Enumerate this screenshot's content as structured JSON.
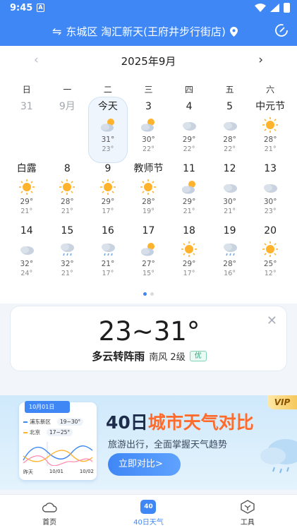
{
  "status_bar": {
    "time": "9:45",
    "notif_glyph": "A"
  },
  "header": {
    "swap_glyph": "⇋",
    "location": "东城区 淘汇新天(王府井步行街店)"
  },
  "calendar": {
    "prev_glyph": "‹",
    "next_glyph": "›",
    "month_title": "2025年9月",
    "weekdays": [
      "日",
      "一",
      "二",
      "三",
      "四",
      "五",
      "六"
    ],
    "weeks": [
      [
        {
          "label": "31",
          "muted": true
        },
        {
          "label": "9月",
          "muted": true
        },
        {
          "label": "今天",
          "icon": "partly-cloudy",
          "hi": "31°",
          "lo": "23°",
          "today": true
        },
        {
          "label": "3",
          "icon": "partly-cloudy",
          "hi": "30°",
          "lo": "22°"
        },
        {
          "label": "4",
          "icon": "cloudy",
          "hi": "29°",
          "lo": "22°"
        },
        {
          "label": "5",
          "icon": "cloudy",
          "hi": "28°",
          "lo": "22°"
        },
        {
          "label": "中元节",
          "icon": "sunny",
          "hi": "28°",
          "lo": "21°"
        }
      ],
      [
        {
          "label": "白露",
          "icon": "sunny",
          "hi": "29°",
          "lo": "21°"
        },
        {
          "label": "8",
          "icon": "sunny",
          "hi": "28°",
          "lo": "21°"
        },
        {
          "label": "9",
          "icon": "sunny",
          "hi": "29°",
          "lo": "17°"
        },
        {
          "label": "教师节",
          "icon": "sunny",
          "hi": "28°",
          "lo": "19°"
        },
        {
          "label": "11",
          "icon": "partly-cloudy",
          "hi": "29°",
          "lo": "21°"
        },
        {
          "label": "12",
          "icon": "cloudy",
          "hi": "30°",
          "lo": "21°"
        },
        {
          "label": "13",
          "icon": "cloudy",
          "hi": "30°",
          "lo": "23°"
        }
      ],
      [
        {
          "label": "14",
          "icon": "cloudy",
          "hi": "32°",
          "lo": "24°"
        },
        {
          "label": "15",
          "icon": "rain",
          "hi": "32°",
          "lo": "21°"
        },
        {
          "label": "16",
          "icon": "rain",
          "hi": "21°",
          "lo": "17°"
        },
        {
          "label": "17",
          "icon": "partly-cloudy",
          "hi": "27°",
          "lo": "15°"
        },
        {
          "label": "18",
          "icon": "sunny",
          "hi": "29°",
          "lo": "17°"
        },
        {
          "label": "19",
          "icon": "rain",
          "hi": "28°",
          "lo": "16°"
        },
        {
          "label": "20",
          "icon": "sunny",
          "hi": "25°",
          "lo": "12°"
        }
      ]
    ]
  },
  "detail": {
    "close_glyph": "✕",
    "temp_range": "23~31°",
    "condition": "多云转阵雨",
    "wind": "南风 2级",
    "aqi": "优"
  },
  "banner": {
    "vip": "VIP",
    "card_date": "10月01日",
    "city1": "浦东新区",
    "city1_range": "19~30°",
    "city2": "北京",
    "city2_range": "17~25°",
    "axis": [
      "昨天",
      "10/01",
      "10/02"
    ],
    "title_num": "40日",
    "title_rest": "城市天气对比",
    "subtitle": "旅游出行，全面掌握天气趋势",
    "cta": "立即对比>",
    "cta_arrow": "›"
  },
  "nav": {
    "tabs": [
      {
        "label": "首页"
      },
      {
        "label": "40日天气",
        "badge": "40",
        "active": true
      },
      {
        "label": "工具"
      }
    ]
  },
  "colors": {
    "accent": "#3f87f5",
    "sun": "#ffb22c",
    "cloud": "#c9d3df",
    "orange": "#ff6b2c",
    "aqi_green": "#2fa57a"
  }
}
